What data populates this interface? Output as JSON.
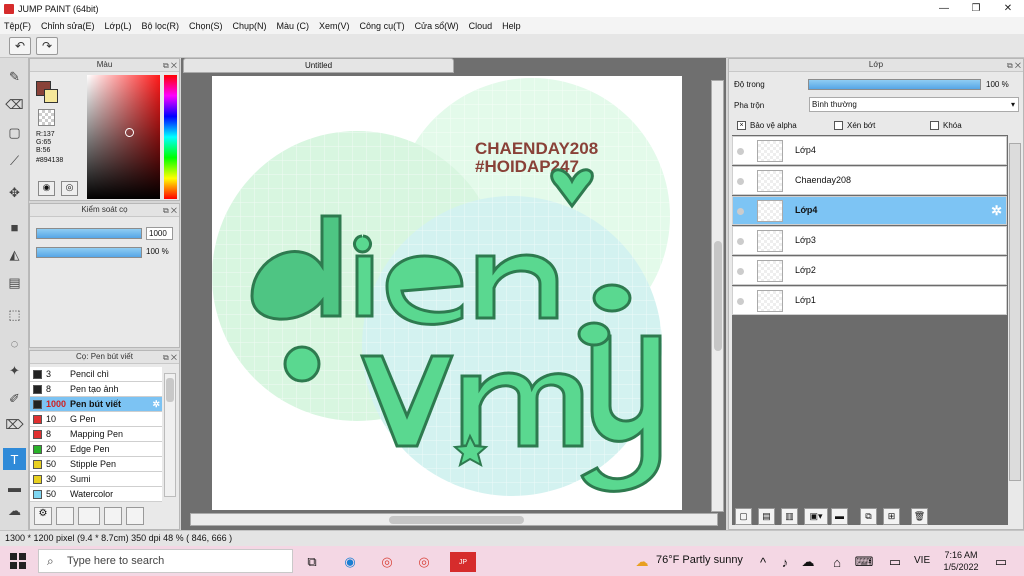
{
  "window": {
    "title": "JUMP PAINT (64bit)"
  },
  "menu": [
    "Tệp(F)",
    "Chỉnh sửa(E)",
    "Lớp(L)",
    "Bộ lọc(R)",
    "Chọn(S)",
    "Chụp(N)",
    "Màu (C)",
    "Xem(V)",
    "Công cụ(T)",
    "Cửa sổ(W)",
    "Cloud",
    "Help"
  ],
  "color_panel": {
    "title": "Màu",
    "r": "R:137",
    "g": "G:65",
    "b": "B:56",
    "hex": "#894138"
  },
  "brush_control": {
    "title": "Kiểm soát cọ",
    "size": "1000",
    "opacity": "100 %"
  },
  "brush_list": {
    "title": "Cọ: Pen bút viết",
    "items": [
      {
        "size": "3",
        "name": "Pencil chì",
        "color": "#222222"
      },
      {
        "size": "8",
        "name": "Pen tạo ảnh",
        "color": "#222222"
      },
      {
        "size": "1000",
        "name": "Pen bút viết",
        "color": "#222222",
        "selected": true
      },
      {
        "size": "10",
        "name": "G Pen",
        "color": "#e03030"
      },
      {
        "size": "8",
        "name": "Mapping Pen",
        "color": "#e03030"
      },
      {
        "size": "20",
        "name": "Edge Pen",
        "color": "#2ab22a"
      },
      {
        "size": "50",
        "name": "Stipple Pen",
        "color": "#e8d020"
      },
      {
        "size": "30",
        "name": "Sumi",
        "color": "#e8d020"
      },
      {
        "size": "50",
        "name": "Watercolor",
        "color": "#7fd7f3"
      }
    ]
  },
  "canvas": {
    "tab": "Untitled",
    "text1": "CHAENDAY208",
    "text2": "#HOIDAP247"
  },
  "layer_panel": {
    "title": "Lớp",
    "opacity_label": "Độ trong",
    "opacity_value": "100 %",
    "blend_label": "Pha trộn",
    "blend_value": "Bình thường",
    "protect_alpha": "Bảo vệ alpha",
    "clip": "Xén bớt",
    "lock": "Khóa",
    "layers": [
      {
        "name": "Lớp4",
        "selected": false
      },
      {
        "name": "Chaenday208",
        "selected": false
      },
      {
        "name": "Lớp4",
        "selected": true
      },
      {
        "name": "Lớp3",
        "selected": false
      },
      {
        "name": "Lớp2",
        "selected": false
      },
      {
        "name": "Lớp1",
        "selected": false
      }
    ]
  },
  "status": "1300 * 1200 pixel  (9.4 * 8.7cm)  350 dpi  48 %  ( 846, 666 )",
  "taskbar": {
    "search_placeholder": "Type here to search",
    "weather": "76°F  Partly sunny",
    "lang": "VIE",
    "time": "7:16 AM",
    "date": "1/5/2022"
  }
}
